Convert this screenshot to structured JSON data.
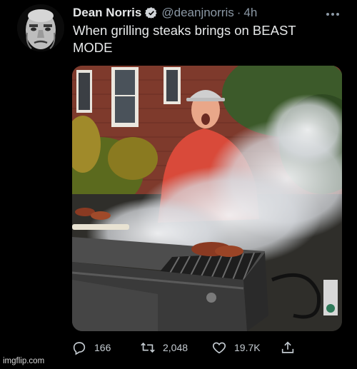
{
  "author": {
    "name": "Dean Norris",
    "handle": "@deanjnorris",
    "separator": "·",
    "time": "4h"
  },
  "tweet": {
    "text": "When grilling steaks brings on BEAST MODE"
  },
  "media": {
    "description_icon": "photo"
  },
  "actions": {
    "replies": "166",
    "retweets": "2,048",
    "likes": "19.7K"
  },
  "watermark": "imgflip.com",
  "colors": {
    "background": "#000000",
    "text": "#e7e9ea",
    "muted": "#8b98a5",
    "verified": "#1d9bf0"
  }
}
